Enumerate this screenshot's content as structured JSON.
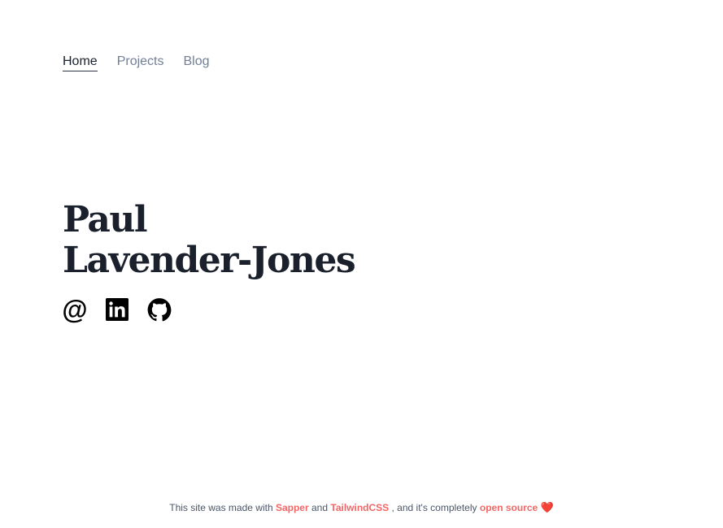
{
  "nav": {
    "items": [
      {
        "label": "Home",
        "active": true
      },
      {
        "label": "Projects",
        "active": false
      },
      {
        "label": "Blog",
        "active": false
      }
    ]
  },
  "hero": {
    "name_line1": "Paul",
    "name_line2": "Lavender-Jones",
    "socials": [
      {
        "icon": "at-icon",
        "glyph": "@"
      },
      {
        "icon": "linkedin-icon"
      },
      {
        "icon": "github-icon"
      }
    ]
  },
  "footer": {
    "prefix": "This site was made with",
    "link_sapper": "Sapper",
    "and": "and",
    "link_tailwind": "TailwindCSS",
    "middle": ", and it's completely",
    "link_open_source": "open source",
    "heart": "❤️"
  },
  "colors": {
    "text_dark": "#1a202c",
    "nav_muted": "#718096",
    "footer_text": "#4a5568",
    "accent": "#f56565"
  }
}
